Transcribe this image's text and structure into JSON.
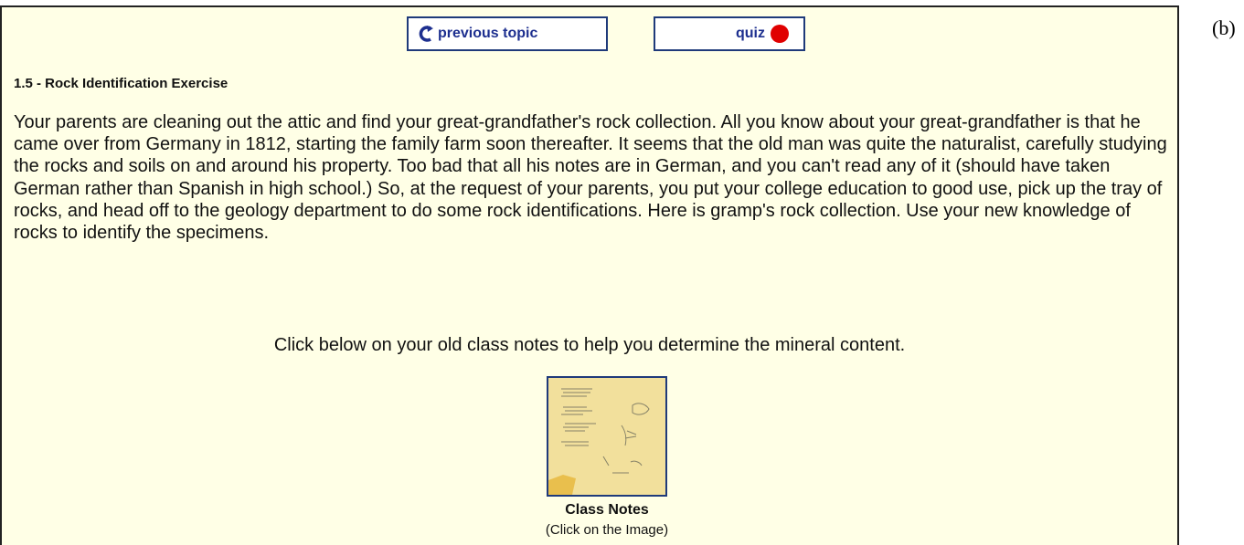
{
  "figure_label": "(b)",
  "nav": {
    "previous_label": "previous topic",
    "quiz_label": "quiz",
    "accent_color": "#1d2f8f",
    "quiz_dot_color": "#e00000"
  },
  "section_title": "1.5 - Rock Identification Exercise",
  "body_text": "Your parents are cleaning out the attic and find your great-grandfather's rock collection. All you know about your great-grandfather is that he came over from Germany in 1812, starting the family farm soon thereafter. It seems that the old man was quite the naturalist, carefully studying the rocks and soils on and around his property. Too bad that all his notes are in German, and you can't read any of it (should have taken German rather than Spanish in high school.) So, at the request of your parents, you put your college education to good use, pick up the tray of rocks, and head off to the geology department to do some rock identifications. Here is gramp's rock collection. Use your new knowledge of rocks to identify the specimens.",
  "instruction": "Click below on your old class notes to help you determine the mineral content.",
  "class_notes": {
    "caption": "Class Notes",
    "hint": "(Click on the Image)",
    "icon": "handwritten-notes-thumbnail"
  },
  "colors": {
    "panel_background": "#ffffe6",
    "button_border": "#1f3a7a"
  }
}
